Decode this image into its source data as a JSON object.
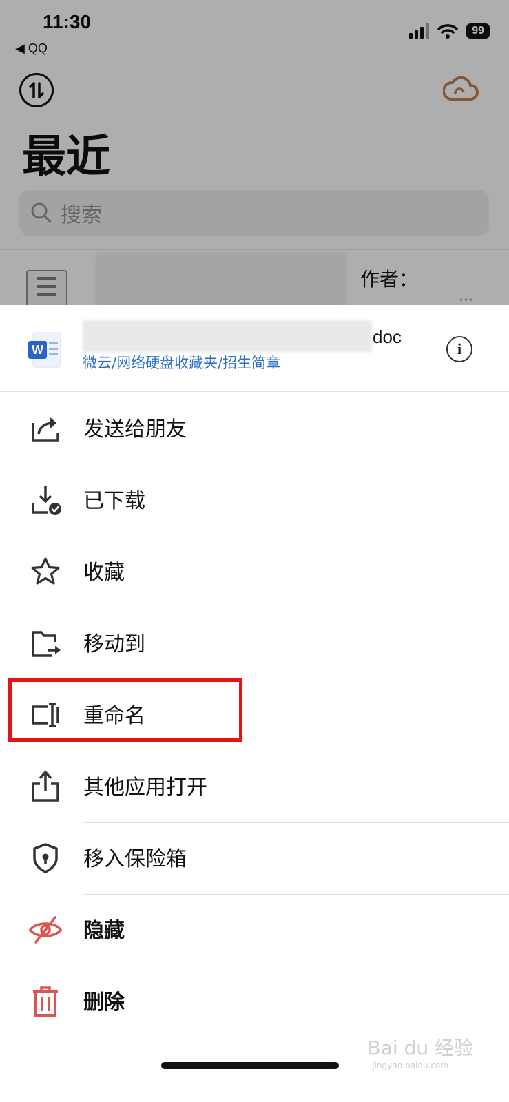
{
  "status_bar": {
    "time": "11:30",
    "back_app": "◀ QQ",
    "battery": "99"
  },
  "background": {
    "title": "最近",
    "search_placeholder": "搜索",
    "row_author": "作者：",
    "row_more": "···"
  },
  "file": {
    "name_suffix": "doc",
    "path": "微云/网络硬盘收藏夹/招生简章"
  },
  "menu": [
    {
      "label": "发送给朋友",
      "icon": "share-icon"
    },
    {
      "label": "已下载",
      "icon": "downloaded-icon"
    },
    {
      "label": "收藏",
      "icon": "star-icon"
    },
    {
      "label": "移动到",
      "icon": "move-folder-icon"
    },
    {
      "label": "重命名",
      "icon": "rename-icon"
    },
    {
      "label": "其他应用打开",
      "icon": "open-in-icon"
    },
    {
      "label": "移入保险箱",
      "icon": "safe-shield-icon"
    },
    {
      "label": "隐藏",
      "icon": "hide-eye-icon"
    },
    {
      "label": "删除",
      "icon": "trash-icon"
    }
  ],
  "colors": {
    "link": "#2c6fcc",
    "danger": "#e0534f",
    "highlight": "#e41414",
    "cloud": "#b77a4b"
  },
  "watermark": {
    "text": "Bai du 经验",
    "sub": "jingyan.baidu.com"
  }
}
